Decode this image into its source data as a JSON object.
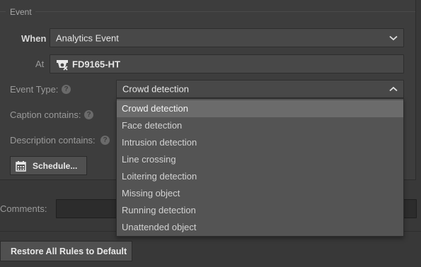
{
  "event": {
    "section_title": "Event",
    "when_label": "When",
    "when_value": "Analytics Event",
    "at_label": "At",
    "at_value": "FD9165-HT",
    "event_type_label": "Event Type:",
    "event_type_value": "Crowd detection",
    "caption_label": "Caption contains:",
    "description_label": "Description contains:",
    "schedule_button": "Schedule..."
  },
  "dropdown": {
    "options": [
      "Crowd detection",
      "Face detection",
      "Intrusion detection",
      "Line crossing",
      "Loitering detection",
      "Missing object",
      "Running detection",
      "Unattended object"
    ],
    "selected": "Crowd detection"
  },
  "comments_label": "Comments:",
  "restore_button": "Restore All Rules to Default",
  "icons": {
    "help": "question-circle-icon",
    "camera": "camera-icon",
    "calendar": "calendar-icon",
    "chevron_down": "chevron-down-icon",
    "chevron_up": "chevron-up-icon"
  }
}
